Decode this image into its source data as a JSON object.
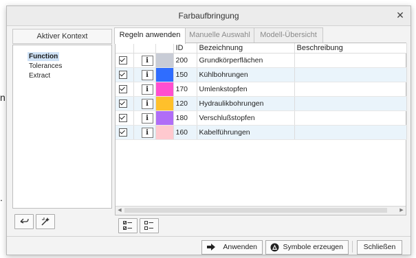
{
  "window": {
    "title": "Farbaufbringung"
  },
  "left_panel": {
    "header": "Aktiver Kontext",
    "items": [
      {
        "label": "Function",
        "selected": true
      },
      {
        "label": "Tolerances",
        "selected": false
      },
      {
        "label": "Extract",
        "selected": false
      }
    ]
  },
  "tabs": [
    {
      "label": "Regeln anwenden",
      "active": true
    },
    {
      "label": "Manuelle Auswahl",
      "active": false
    },
    {
      "label": "Modell-Übersicht",
      "active": false
    }
  ],
  "grid": {
    "columns": [
      "",
      "",
      "",
      "ID",
      "Bezeichnung",
      "Beschreibung"
    ],
    "info_glyph": "i",
    "rows": [
      {
        "checked": true,
        "color": "#c8ccd6",
        "id": "200",
        "name": "Grundkörperflächen",
        "desc": ""
      },
      {
        "checked": true,
        "color": "#2f6dff",
        "id": "150",
        "name": "Kühlbohrungen",
        "desc": ""
      },
      {
        "checked": true,
        "color": "#ff4fd0",
        "id": "170",
        "name": "Umlenkstopfen",
        "desc": ""
      },
      {
        "checked": true,
        "color": "#ffc02b",
        "id": "120",
        "name": "Hydraulikbohrungen",
        "desc": ""
      },
      {
        "checked": true,
        "color": "#b06df7",
        "id": "180",
        "name": "Verschlußstopfen",
        "desc": ""
      },
      {
        "checked": true,
        "color": "#ffc9cf",
        "id": "160",
        "name": "Kabelführungen",
        "desc": ""
      }
    ]
  },
  "footer": {
    "apply_label": "Anwenden",
    "symbols_label": "Symbole erzeugen",
    "close_label": "Schließen"
  },
  "background": {
    "mark_1": "n",
    "mark_2": "."
  }
}
